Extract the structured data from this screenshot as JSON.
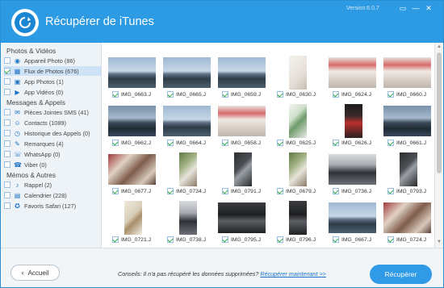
{
  "app": {
    "title": "Récupérer de iTunes",
    "version": "Version:6.0.7",
    "controls": [
      "▭",
      "—",
      "✕"
    ]
  },
  "sidebar": {
    "sections": [
      {
        "title": "Photos & Vidéos",
        "items": [
          {
            "label": "Appareil Photo (86)",
            "icon": "camera-icon",
            "glyph": "◉"
          },
          {
            "label": "Flux de Photos (676)",
            "icon": "photo-stream-icon",
            "glyph": "▦",
            "selected": true
          },
          {
            "label": "App Photos (1)",
            "icon": "image-icon",
            "glyph": "▣"
          },
          {
            "label": "App Vidéos (0)",
            "icon": "video-icon",
            "glyph": "▶"
          }
        ]
      },
      {
        "title": "Messages & Appels",
        "items": [
          {
            "label": "Pièces Jointes SMS (41)",
            "icon": "attachment-icon",
            "glyph": "✉"
          },
          {
            "label": "Contacts (1089)",
            "icon": "contacts-icon",
            "glyph": "☺"
          },
          {
            "label": "Historique des Appels (0)",
            "icon": "call-history-icon",
            "glyph": "◷"
          },
          {
            "label": "Remarques (4)",
            "icon": "notes-icon",
            "glyph": "✎"
          },
          {
            "label": "WhatsApp (0)",
            "icon": "whatsapp-icon",
            "glyph": "☏"
          },
          {
            "label": "Viber (0)",
            "icon": "viber-icon",
            "glyph": "☎"
          }
        ]
      },
      {
        "title": "Mémos & Autres",
        "items": [
          {
            "label": "Rappel (2)",
            "icon": "reminder-icon",
            "glyph": "♪"
          },
          {
            "label": "Calendrier (228)",
            "icon": "calendar-icon",
            "glyph": "▤"
          },
          {
            "label": "Favoris Safari (127)",
            "icon": "safari-icon",
            "glyph": "✪"
          }
        ]
      }
    ]
  },
  "photos": [
    {
      "name": "IMG_0663.J",
      "scene": "lake-sky",
      "orient": "land"
    },
    {
      "name": "IMG_0665.J",
      "scene": "lake-sky",
      "orient": "land"
    },
    {
      "name": "IMG_0659.J",
      "scene": "lake-sky",
      "orient": "land"
    },
    {
      "name": "IMG_0630.J",
      "scene": "bright-indoor",
      "orient": "port"
    },
    {
      "name": "IMG_0624.J",
      "scene": "sign-red",
      "orient": "land"
    },
    {
      "name": "IMG_0660.J",
      "scene": "sign-red",
      "orient": "land"
    },
    {
      "name": "IMG_0662.J",
      "scene": "lake-dark",
      "orient": "land"
    },
    {
      "name": "IMG_0664.J",
      "scene": "lake-sky",
      "orient": "land"
    },
    {
      "name": "IMG_0658.J",
      "scene": "sign-red",
      "orient": "land"
    },
    {
      "name": "IMG_0625.J",
      "scene": "green-white",
      "orient": "port"
    },
    {
      "name": "IMG_0626.J",
      "scene": "dark-red",
      "orient": "port"
    },
    {
      "name": "IMG_0661.J",
      "scene": "lake-dark",
      "orient": "land"
    },
    {
      "name": "IMG_0677.J",
      "scene": "food",
      "orient": "land"
    },
    {
      "name": "IMG_0734.J",
      "scene": "plant",
      "orient": "port"
    },
    {
      "name": "IMG_0791.J",
      "scene": "dark-device",
      "orient": "port"
    },
    {
      "name": "IMG_0679.J",
      "scene": "plant",
      "orient": "port"
    },
    {
      "name": "IMG_0736.J",
      "scene": "car",
      "orient": "land"
    },
    {
      "name": "IMG_0793.J",
      "scene": "dark-device",
      "orient": "port"
    },
    {
      "name": "IMG_0721.J",
      "scene": "paper",
      "orient": "port"
    },
    {
      "name": "IMG_0738.J",
      "scene": "car",
      "orient": "port"
    },
    {
      "name": "IMG_0795.J",
      "scene": "keyboard",
      "orient": "land"
    },
    {
      "name": "IMG_0796.J",
      "scene": "keyboard",
      "orient": "port"
    },
    {
      "name": "IMG_0667.J",
      "scene": "lake-sky",
      "orient": "land"
    },
    {
      "name": "IMG_0724.J",
      "scene": "food",
      "orient": "land"
    }
  ],
  "footer": {
    "back_label": "Accueil",
    "tip_text": "Conseils: Il n'a pas récupéré les données supprimées? ",
    "tip_link": "Récupérer maintenant >>",
    "recover_label": "Récupérer"
  }
}
